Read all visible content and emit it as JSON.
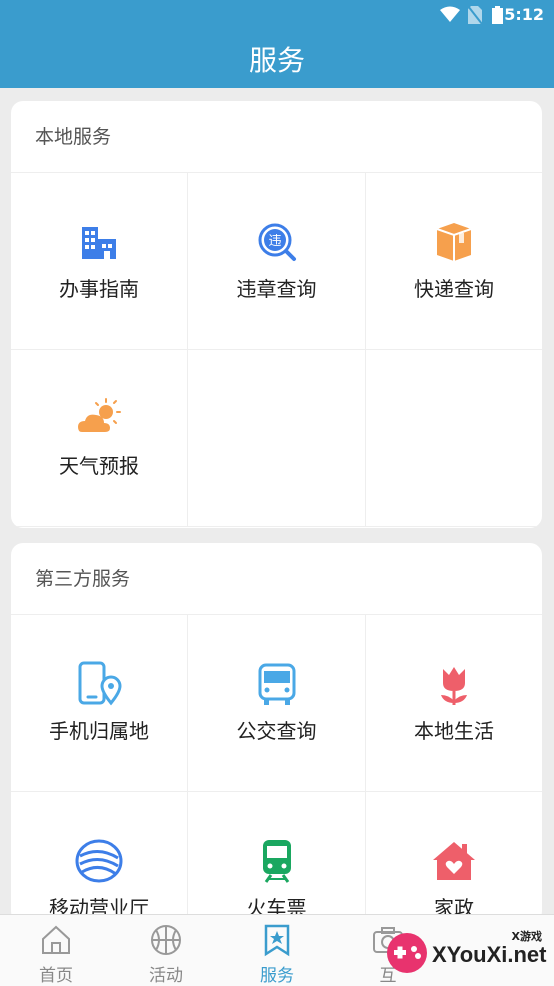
{
  "status_bar": {
    "time": "5:12",
    "icons": [
      "wifi-icon",
      "no-sim-icon",
      "battery-icon"
    ]
  },
  "header": {
    "title": "服务"
  },
  "local_services": {
    "title": "本地服务",
    "items": [
      {
        "label": "办事指南",
        "icon": "buildings-icon"
      },
      {
        "label": "违章查询",
        "icon": "violation-search-icon"
      },
      {
        "label": "快递查询",
        "icon": "package-icon"
      },
      {
        "label": "天气预报",
        "icon": "weather-icon"
      }
    ]
  },
  "third_party_services": {
    "title": "第三方服务",
    "items": [
      {
        "label": "手机归属地",
        "icon": "phone-location-icon"
      },
      {
        "label": "公交查询",
        "icon": "bus-icon"
      },
      {
        "label": "本地生活",
        "icon": "tulip-icon"
      },
      {
        "label": "移动营业厅",
        "icon": "china-mobile-icon"
      },
      {
        "label": "火车票",
        "icon": "train-icon"
      },
      {
        "label": "家政",
        "icon": "house-heart-icon"
      }
    ]
  },
  "tab_bar": {
    "active": "服务",
    "tabs": [
      {
        "label": "首页",
        "icon": "home-icon"
      },
      {
        "label": "活动",
        "icon": "basketball-icon"
      },
      {
        "label": "服务",
        "icon": "bookmark-star-icon"
      },
      {
        "label": "互",
        "icon": "camera-icon"
      }
    ]
  },
  "watermark": {
    "text": "XYouXi.net",
    "sub": "X游戏"
  },
  "colors": {
    "primary": "#3a9ccd",
    "blue": "#3d7ee8",
    "orange": "#f6a04d",
    "red": "#ee5f6a",
    "green": "#1aa760",
    "sky": "#4aa8e6"
  }
}
